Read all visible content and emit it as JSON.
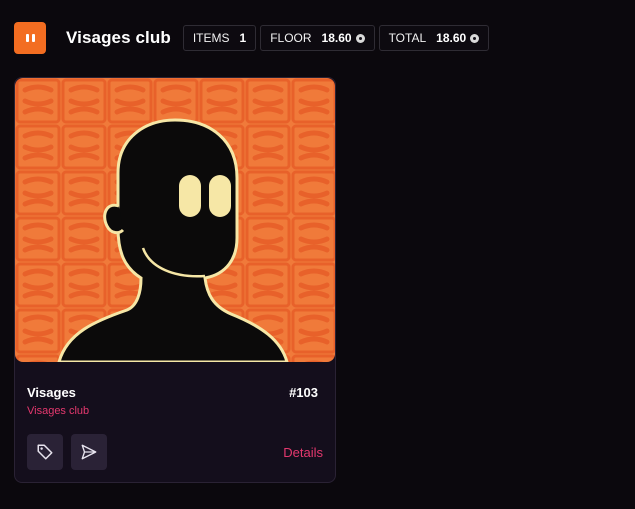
{
  "header": {
    "logo_icon": "pause-logo-icon",
    "title": "Visages club",
    "stats": [
      {
        "label": "ITEMS",
        "value": "1",
        "coin": false
      },
      {
        "label": "FLOOR",
        "value": "18.60",
        "coin": true
      },
      {
        "label": "TOTAL",
        "value": "18.60",
        "coin": true
      }
    ]
  },
  "card": {
    "name": "Visages",
    "token_id": "#103",
    "collection": "Visages club",
    "details_label": "Details",
    "actions": [
      {
        "icon": "tag-icon"
      },
      {
        "icon": "send-icon"
      }
    ]
  },
  "colors": {
    "background": "#0b080d",
    "brand_orange": "#f36d21",
    "accent_pink": "#e4386e",
    "card_bg": "#140e1c",
    "art_bg": "#f07a3a",
    "art_pattern": "#e8612a",
    "outline": "#f6e7a6"
  }
}
